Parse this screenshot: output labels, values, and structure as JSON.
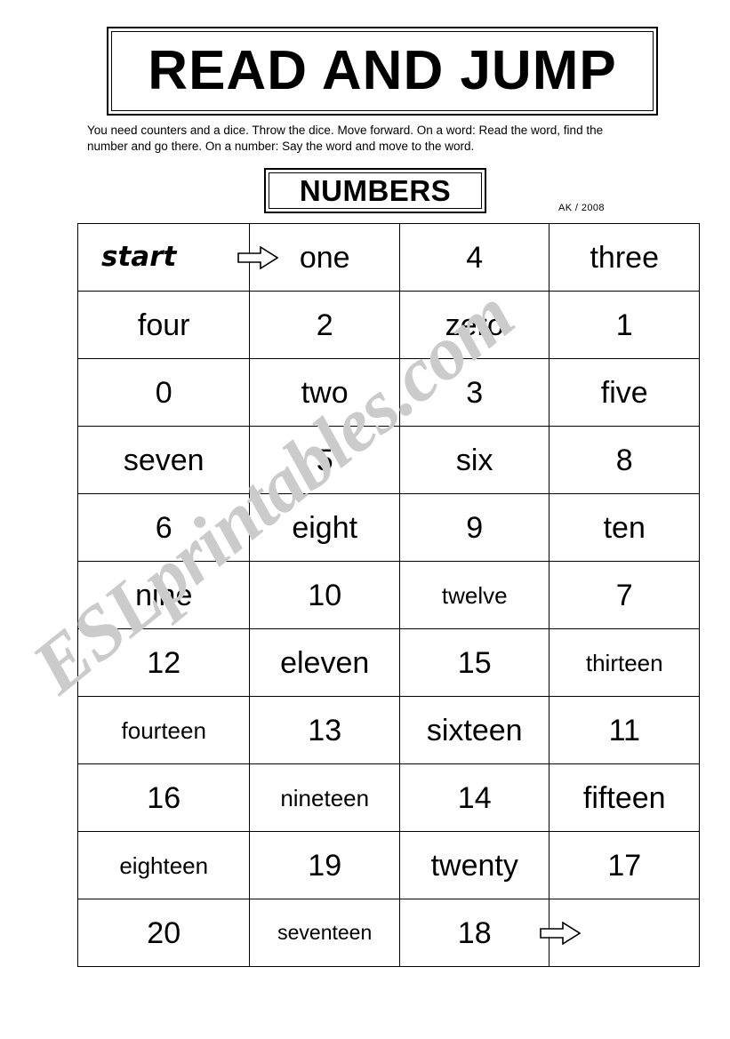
{
  "title": "READ AND JUMP",
  "instructions": "You need counters and a dice. Throw the dice. Move forward. On a word: Read the word, find the number and go there. On a number: Say the word and move to the word.",
  "subtitle": "NUMBERS",
  "credit": "AK / 2008",
  "watermark": "ESLprintables.com",
  "colors": {
    "ink": "#000000",
    "page": "#ffffff",
    "watermark": "#cbcbcb"
  },
  "board": {
    "columns": 4,
    "rows": 11,
    "cells": [
      [
        {
          "text": "start",
          "style": "start",
          "arrow": "start"
        },
        {
          "text": "one",
          "style": "normal"
        },
        {
          "text": "4",
          "style": "normal"
        },
        {
          "text": "three",
          "style": "normal"
        }
      ],
      [
        {
          "text": "four",
          "style": "normal"
        },
        {
          "text": "2",
          "style": "normal"
        },
        {
          "text": "zero",
          "style": "normal"
        },
        {
          "text": "1",
          "style": "normal"
        }
      ],
      [
        {
          "text": "0",
          "style": "normal"
        },
        {
          "text": "two",
          "style": "normal"
        },
        {
          "text": "3",
          "style": "normal"
        },
        {
          "text": "five",
          "style": "normal"
        }
      ],
      [
        {
          "text": "seven",
          "style": "normal"
        },
        {
          "text": "5",
          "style": "normal"
        },
        {
          "text": "six",
          "style": "normal"
        },
        {
          "text": "8",
          "style": "normal"
        }
      ],
      [
        {
          "text": "6",
          "style": "normal"
        },
        {
          "text": "eight",
          "style": "normal"
        },
        {
          "text": "9",
          "style": "normal"
        },
        {
          "text": "ten",
          "style": "normal"
        }
      ],
      [
        {
          "text": "nine",
          "style": "normal"
        },
        {
          "text": "10",
          "style": "normal"
        },
        {
          "text": "twelve",
          "style": "small"
        },
        {
          "text": "7",
          "style": "normal"
        }
      ],
      [
        {
          "text": "12",
          "style": "normal"
        },
        {
          "text": "eleven",
          "style": "normal"
        },
        {
          "text": "15",
          "style": "normal"
        },
        {
          "text": "thirteen",
          "style": "small"
        }
      ],
      [
        {
          "text": "fourteen",
          "style": "small"
        },
        {
          "text": "13",
          "style": "normal"
        },
        {
          "text": "sixteen",
          "style": "normal"
        },
        {
          "text": "11",
          "style": "normal"
        }
      ],
      [
        {
          "text": "16",
          "style": "normal"
        },
        {
          "text": "nineteen",
          "style": "small"
        },
        {
          "text": "14",
          "style": "normal"
        },
        {
          "text": "fifteen",
          "style": "normal"
        }
      ],
      [
        {
          "text": "eighteen",
          "style": "small"
        },
        {
          "text": "19",
          "style": "normal"
        },
        {
          "text": "twenty",
          "style": "normal"
        },
        {
          "text": "17",
          "style": "normal"
        }
      ],
      [
        {
          "text": "20",
          "style": "normal"
        },
        {
          "text": "seventeen",
          "style": "xsmall"
        },
        {
          "text": "18",
          "style": "normal",
          "arrow": "end"
        },
        {
          "text": "",
          "style": "normal"
        }
      ]
    ]
  }
}
